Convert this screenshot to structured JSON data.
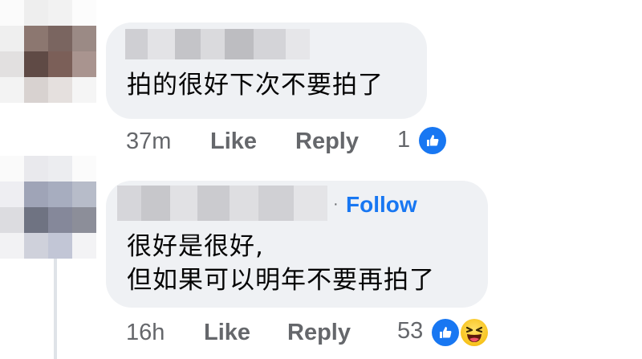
{
  "comments": [
    {
      "text_lines": [
        "拍的很好下次不要拍了"
      ],
      "time": "37m",
      "like_label": "Like",
      "reply_label": "Reply",
      "reaction_count": "1",
      "reactions": [
        "like-icon"
      ]
    },
    {
      "follow_label": "Follow",
      "text_lines": [
        "很好是很好,",
        "但如果可以明年不要再拍了"
      ],
      "time": "16h",
      "like_label": "Like",
      "reply_label": "Reply",
      "reaction_count": "53",
      "reactions": [
        "like-icon",
        "haha-icon"
      ]
    }
  ],
  "colors": {
    "bubble": "#eff1f4",
    "meta_text": "#65676b",
    "follow_link": "#1877f2",
    "like_badge": "#1877f2",
    "comment_text": "#050505"
  }
}
